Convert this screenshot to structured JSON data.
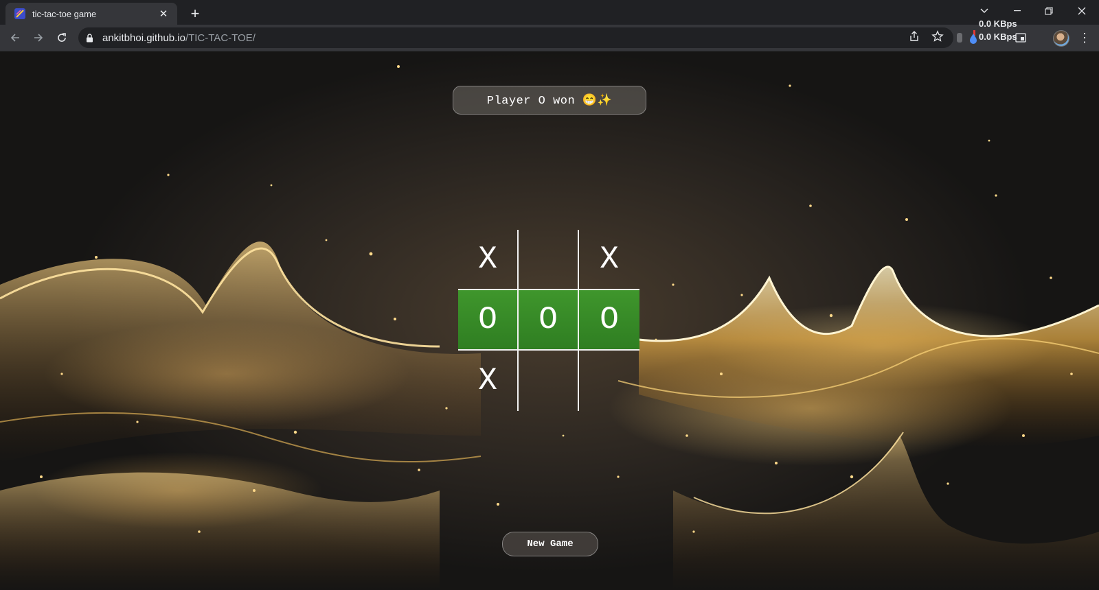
{
  "browser": {
    "tab_title": "tic-tac-toe game",
    "url_host": "ankitbhoi.github.io",
    "url_path": "/TIC-TAC-TOE/",
    "net_up": "0.0 KBps",
    "net_down": "0.0 KBps"
  },
  "game": {
    "status": "Player O won 😁✨",
    "board": [
      [
        "X",
        "",
        "X"
      ],
      [
        "O",
        "O",
        "O"
      ],
      [
        "X",
        "",
        ""
      ]
    ],
    "winning_row": 1,
    "win_color": "#3f962c",
    "new_game_label": "New Game"
  }
}
